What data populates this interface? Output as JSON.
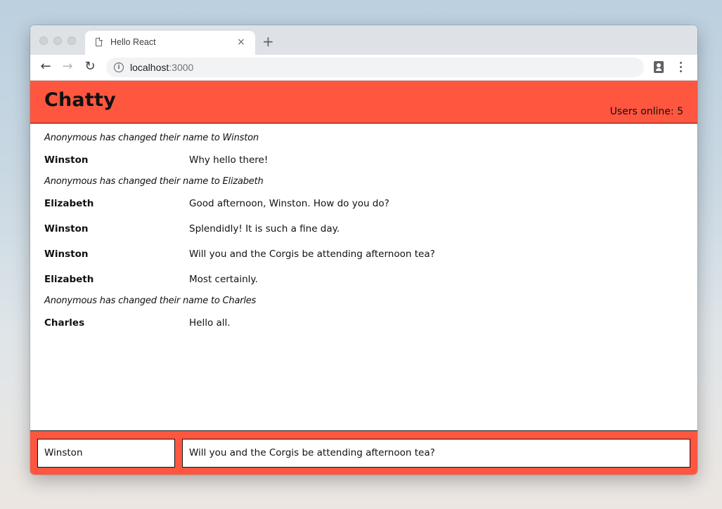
{
  "browser": {
    "tab_title": "Hello React",
    "tab_close": "×",
    "new_tab": "+",
    "nav": {
      "back": "←",
      "forward": "→",
      "reload": "↻"
    },
    "url_host": "localhost",
    "url_port": ":3000",
    "info_glyph": "i"
  },
  "app": {
    "brand": "Chatty",
    "users_online": "Users online: 5",
    "accent_color": "#ff5640"
  },
  "messages": [
    {
      "type": "notification",
      "content": "Anonymous has changed their name to Winston"
    },
    {
      "type": "message",
      "username": "Winston",
      "content": "Why hello there!"
    },
    {
      "type": "notification",
      "content": "Anonymous has changed their name to Elizabeth"
    },
    {
      "type": "message",
      "username": "Elizabeth",
      "content": "Good afternoon, Winston. How do you do?"
    },
    {
      "type": "message",
      "username": "Winston",
      "content": "Splendidly! It is such a fine day."
    },
    {
      "type": "message",
      "username": "Winston",
      "content": "Will you and the Corgis be attending afternoon tea?"
    },
    {
      "type": "message",
      "username": "Elizabeth",
      "content": "Most certainly."
    },
    {
      "type": "notification",
      "content": "Anonymous has changed their name to Charles"
    },
    {
      "type": "message",
      "username": "Charles",
      "content": "Hello all."
    }
  ],
  "chatbar": {
    "username_value": "Winston",
    "message_value": "Will you and the Corgis be attending afternoon tea?"
  }
}
